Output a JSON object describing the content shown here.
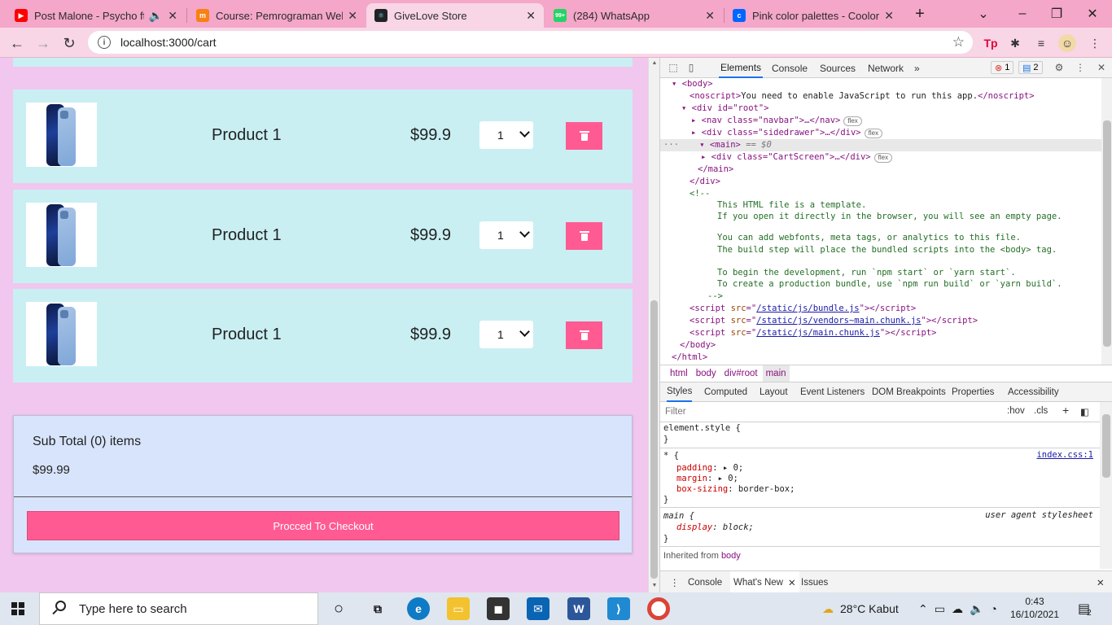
{
  "browser": {
    "tabs": [
      {
        "title": "Post Malone - Psycho ft. Ty Dolla $ign",
        "favicon": "youtube-icon",
        "color": "#ff0000"
      },
      {
        "title": "Course: Pemrograman Web dan Perangkat Bergerak",
        "favicon": "moodle-icon",
        "color": "#f98012"
      },
      {
        "title": "GiveLove Store",
        "favicon": "react-icon",
        "color": "#222222"
      },
      {
        "title": "(284) WhatsApp",
        "favicon": "whatsapp-icon",
        "color": "#25d366",
        "badge": "99+"
      },
      {
        "title": "Pink color palettes - Coolors",
        "favicon": "coolors-icon",
        "color": "#0066ff"
      }
    ],
    "url": "localhost:3000/cart"
  },
  "cart": {
    "items": [
      {
        "name": "Product 1",
        "price": "$99.9",
        "qty": "1"
      },
      {
        "name": "Product 1",
        "price": "$99.9",
        "qty": "1"
      },
      {
        "name": "Product 1",
        "price": "$99.9",
        "qty": "1"
      }
    ],
    "subtotal_label": "Sub Total (0) items",
    "subtotal_value": "$99.99",
    "checkout_label": "Procced To Checkout"
  },
  "devtools": {
    "tabs": [
      "Elements",
      "Console",
      "Sources",
      "Network"
    ],
    "error_count": "1",
    "message_count": "2",
    "dom": {
      "body_open": "<body>",
      "noscript": "You need to enable JavaScript to run this app.",
      "root": "<div id=\"root\">",
      "nav": "<nav class=\"navbar\">…</nav>",
      "sidedrawer": "<div class=\"sidedrawer\">…</div>",
      "main": "<main>",
      "main_ref": "== $0",
      "cartscreen": "<div class=\"CartScreen\">…</div>",
      "main_close": "</main>",
      "div_close": "</div>",
      "comment_open": "<!--",
      "comment_lines": [
        "This HTML file is a template.",
        "If you open it directly in the browser, you will see an empty page.",
        "You can add webfonts, meta tags, or analytics to this file.",
        "The build step will place the bundled scripts into the <body> tag.",
        "To begin the development, run `npm start` or `yarn start`.",
        "To create a production bundle, use `npm run build` or `yarn build`."
      ],
      "comment_close": "-->",
      "scripts": [
        "/static/js/bundle.js",
        "/static/js/vendors~main.chunk.js",
        "/static/js/main.chunk.js"
      ],
      "body_close": "</body>",
      "html_close": "</html>",
      "flex_pill": "flex"
    },
    "breadcrumbs": [
      "html",
      "body",
      "div#root",
      "main"
    ],
    "style_tabs": [
      "Styles",
      "Computed",
      "Layout",
      "Event Listeners",
      "DOM Breakpoints",
      "Properties",
      "Accessibility"
    ],
    "filter_placeholder": "Filter",
    "hov": ":hov",
    "cls": ".cls",
    "rules": {
      "element_style": "element.style {",
      "close": "}",
      "star_selector": "* {",
      "star_source": "index.css:1",
      "padding": "padding",
      "padding_val": "0;",
      "margin": "margin",
      "margin_val": "0;",
      "box_sizing": "box-sizing",
      "box_sizing_val": "border-box;",
      "main_selector": "main {",
      "main_source": "user agent stylesheet",
      "display": "display",
      "display_val": "block;",
      "inherited_label": "Inherited from",
      "inherited_el": "body"
    },
    "drawer_tabs": [
      "Console",
      "What's New",
      "Issues"
    ]
  },
  "taskbar": {
    "search_placeholder": "Type here to search",
    "weather": "28°C  Kabut",
    "time": "0:43",
    "date": "16/10/2021",
    "notifications": "2"
  }
}
